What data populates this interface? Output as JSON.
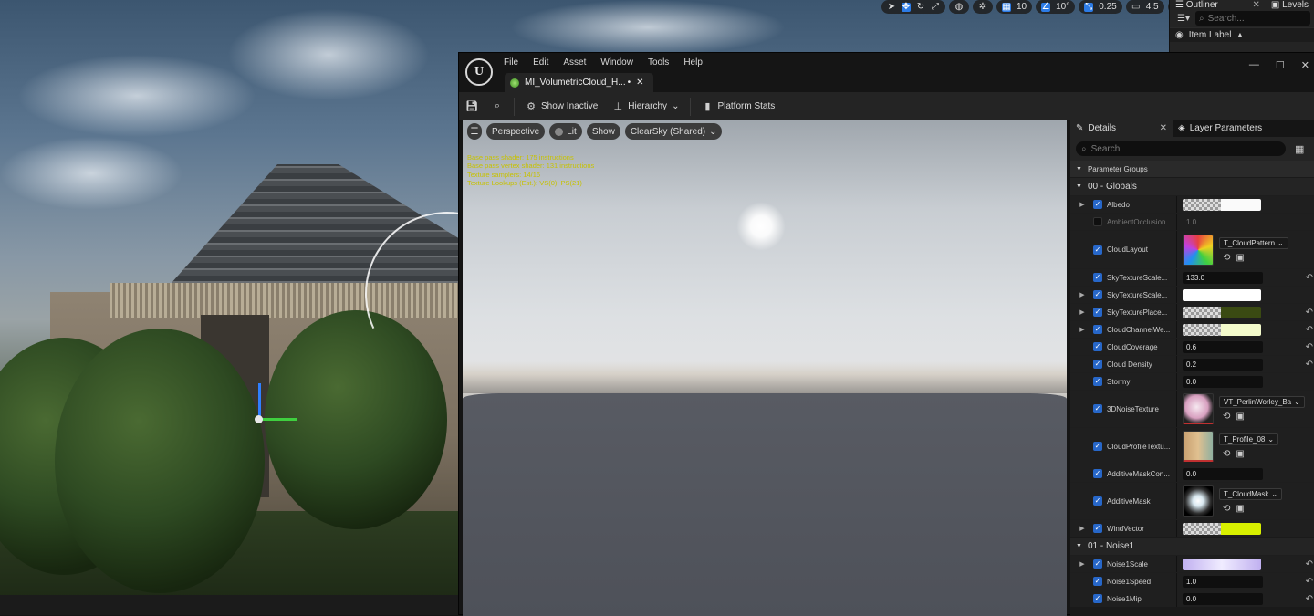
{
  "level_toolbar": {
    "grid_snap": "10",
    "rotation_snap": "10°",
    "scale_snap": "0.25",
    "camera_speed": "4.5"
  },
  "outliner": {
    "title": "Outliner",
    "levels_tab": "Levels",
    "search_placeholder": "Search...",
    "column_label": "Item Label"
  },
  "window": {
    "menu": [
      "File",
      "Edit",
      "Asset",
      "Window",
      "Tools",
      "Help"
    ],
    "tab_title": "MI_VolumetricCloud_H...",
    "tab_modified": "•",
    "controls": {
      "minimize": "—",
      "maximize": "☐",
      "close": "✕"
    }
  },
  "toolbar": {
    "show_inactive": "Show Inactive",
    "hierarchy": "Hierarchy",
    "platform_stats": "Platform Stats"
  },
  "viewport": {
    "perspective": "Perspective",
    "lit": "Lit",
    "show": "Show",
    "sky_preset": "ClearSky (Shared)",
    "stats": [
      "Base pass shader: 175 instructions",
      "Base pass vertex shader: 131 instructions",
      "Texture samplers: 14/16",
      "Texture Lookups (Est.): VS(0), PS(21)"
    ]
  },
  "details": {
    "tab_details": "Details",
    "tab_layer_params": "Layer Parameters",
    "search_placeholder": "Search",
    "section_title": "Parameter Groups",
    "group_globals": "00 - Globals",
    "group_noise1": "01 - Noise1",
    "params": {
      "albedo": "Albedo",
      "ambient_occlusion": "AmbientOcclusion",
      "ambient_occlusion_value": "1.0",
      "cloud_layout": "CloudLayout",
      "cloud_layout_tex": "T_CloudPattern",
      "sky_texture_scale": "SkyTextureScale...",
      "sky_texture_scale_value": "133.0",
      "sky_texture_scale2": "SkyTextureScale...",
      "sky_texture_place": "SkyTexturePlace...",
      "cloud_channel": "CloudChannelWe...",
      "cloud_coverage": "CloudCoverage",
      "cloud_coverage_value": "0.6",
      "cloud_density": "Cloud Density",
      "cloud_density_value": "0.2",
      "stormy": "Stormy",
      "stormy_value": "0.0",
      "noise3d": "3DNoiseTexture",
      "noise3d_tex": "VT_PerlinWorley_Ba",
      "cloud_profile": "CloudProfileTextu...",
      "cloud_profile_tex": "T_Profile_08",
      "additive_mask_con": "AdditiveMaskCon...",
      "additive_mask_con_value": "0.0",
      "additive_mask": "AdditiveMask",
      "additive_mask_tex": "T_CloudMask",
      "wind_vector": "WindVector",
      "noise1_scale": "Noise1Scale",
      "noise1_speed": "Noise1Speed",
      "noise1_speed_value": "1.0",
      "noise1_mip": "Noise1Mip",
      "noise1_mip_value": "0.0"
    }
  },
  "colors": {
    "accent_blue": "#2767c9",
    "stats_yellow": "#c7c200",
    "sky_place_color": "#3a4a12",
    "cloud_channel_color": "#f4fbcc",
    "wind_vector_color": "#d8f000",
    "noise1_scale_gradient": "#e6dcff"
  }
}
